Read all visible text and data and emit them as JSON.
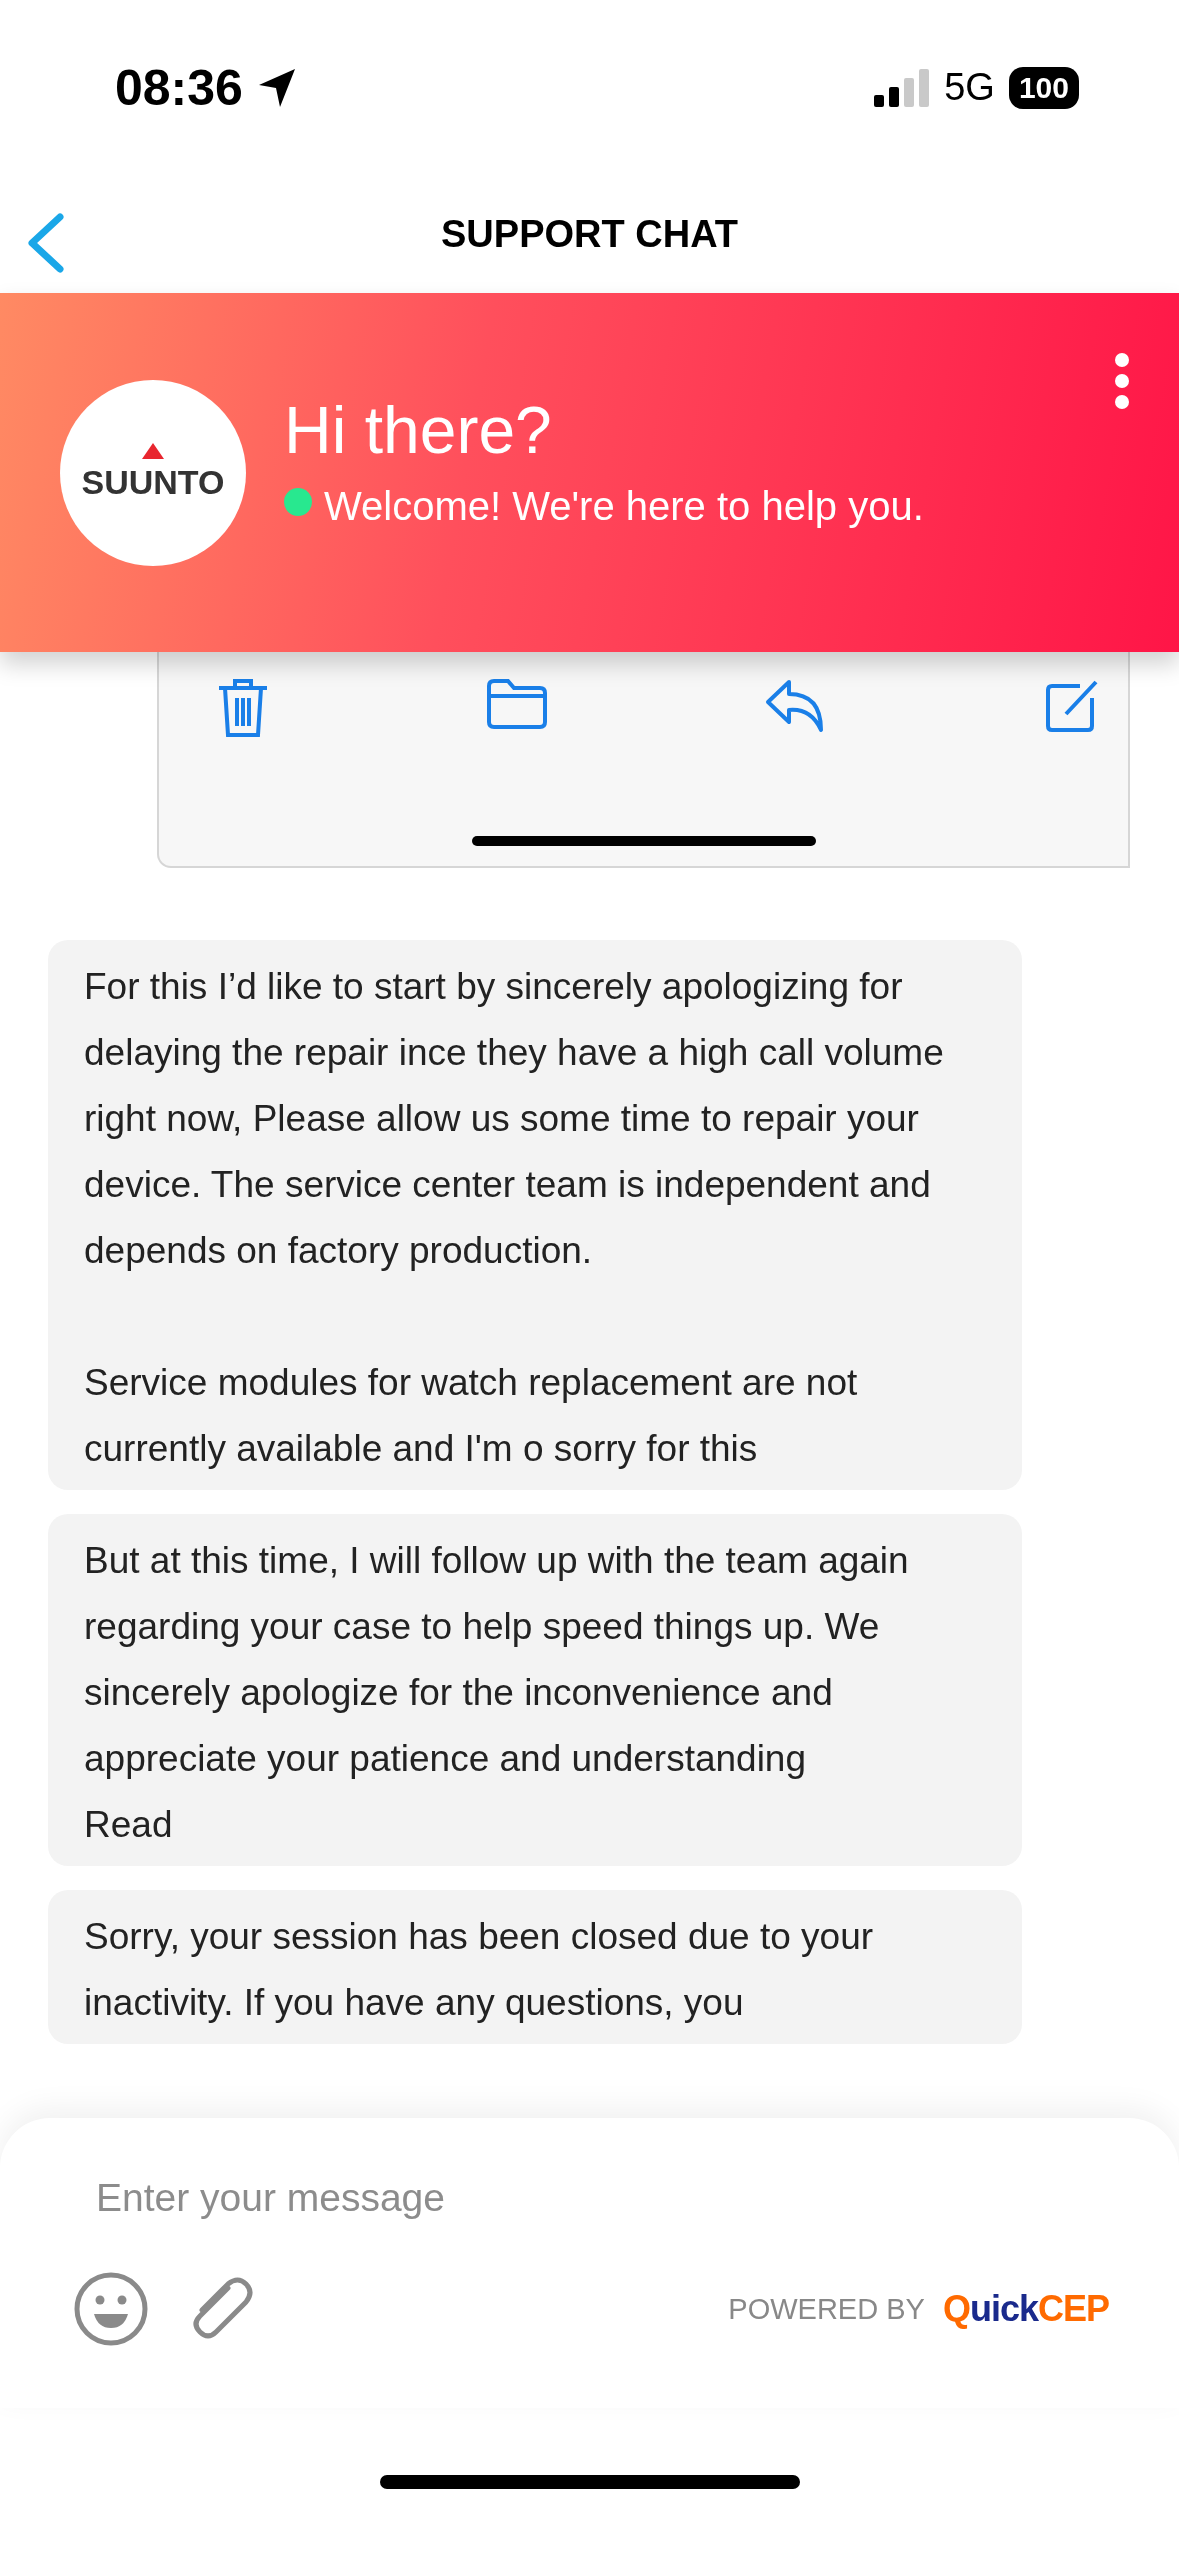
{
  "status_bar": {
    "time": "08:36",
    "network": "5G",
    "battery": "100"
  },
  "nav": {
    "title": "SUPPORT CHAT"
  },
  "header": {
    "logo_text": "SUUNTO",
    "title": "Hi there?",
    "online": true,
    "subtitle": "Welcome! We're here to help you."
  },
  "messages": [
    {
      "text": "For this I’d like to start by sincerely apologizing for delaying the repair ince they have a high call volume right now, Please allow us some time to repair your device. The service center team is independent and depends on factory production.\n\nService modules for watch replacement are not currently available and I'm o sorry for this"
    },
    {
      "text": "But at this time, I will follow up with the team again regarding your case to help speed things up. We sincerely apologize for the inconvenience and appreciate your patience and understanding",
      "status": "Read"
    },
    {
      "text": "Sorry, your session has been closed due to your inactivity. If you have any questions, you"
    }
  ],
  "composer": {
    "placeholder": "Enter your message",
    "powered_by": "POWERED BY",
    "brand": [
      {
        "text": "Q",
        "color": "#ff6a00"
      },
      {
        "text": "uick",
        "color": "#1a2a8c"
      },
      {
        "text": "CEP",
        "color": "#ff6a00"
      }
    ]
  }
}
